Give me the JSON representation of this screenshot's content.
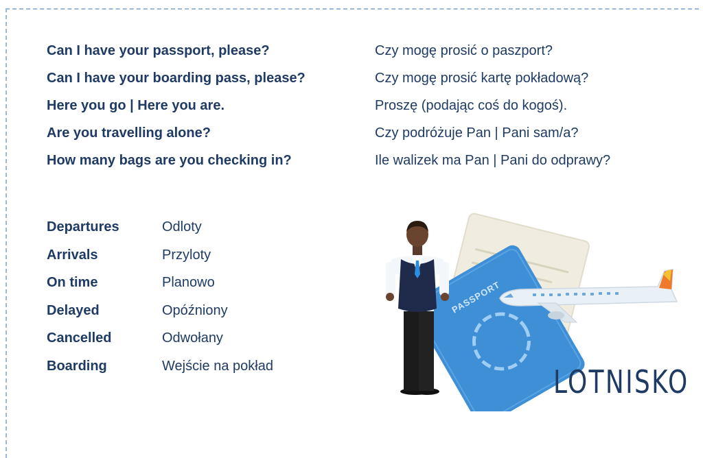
{
  "phrases": [
    {
      "en": "Can I have your passport, please?",
      "pl": "Czy mogę prosić o paszport?"
    },
    {
      "en": "Can I have your boarding pass, please?",
      "pl": "Czy mogę prosić kartę pokładową?"
    },
    {
      "en": "Here you go | Here you are.",
      "pl": "Proszę (podając coś do kogoś)."
    },
    {
      "en": "Are you travelling alone?",
      "pl": "Czy podróżuje Pan | Pani sam/a?"
    },
    {
      "en": "How many bags are you checking in?",
      "pl": "Ile walizek ma Pan | Pani do odprawy?"
    }
  ],
  "vocab": [
    {
      "en": "Departures",
      "pl": "Odloty"
    },
    {
      "en": "Arrivals",
      "pl": "Przyloty"
    },
    {
      "en": "On time",
      "pl": "Planowo"
    },
    {
      "en": "Delayed",
      "pl": "Opóźniony"
    },
    {
      "en": "Cancelled",
      "pl": "Odwołany"
    },
    {
      "en": "Boarding",
      "pl": "Wejście na pokład"
    }
  ],
  "illustration": {
    "passport_text": "PASSPORT",
    "title": "LOTNISKO"
  },
  "colors": {
    "text": "#1f3b64",
    "border": "#9bb8dc",
    "passport": "#3f8fd6",
    "ticket": "#f1ece0"
  }
}
